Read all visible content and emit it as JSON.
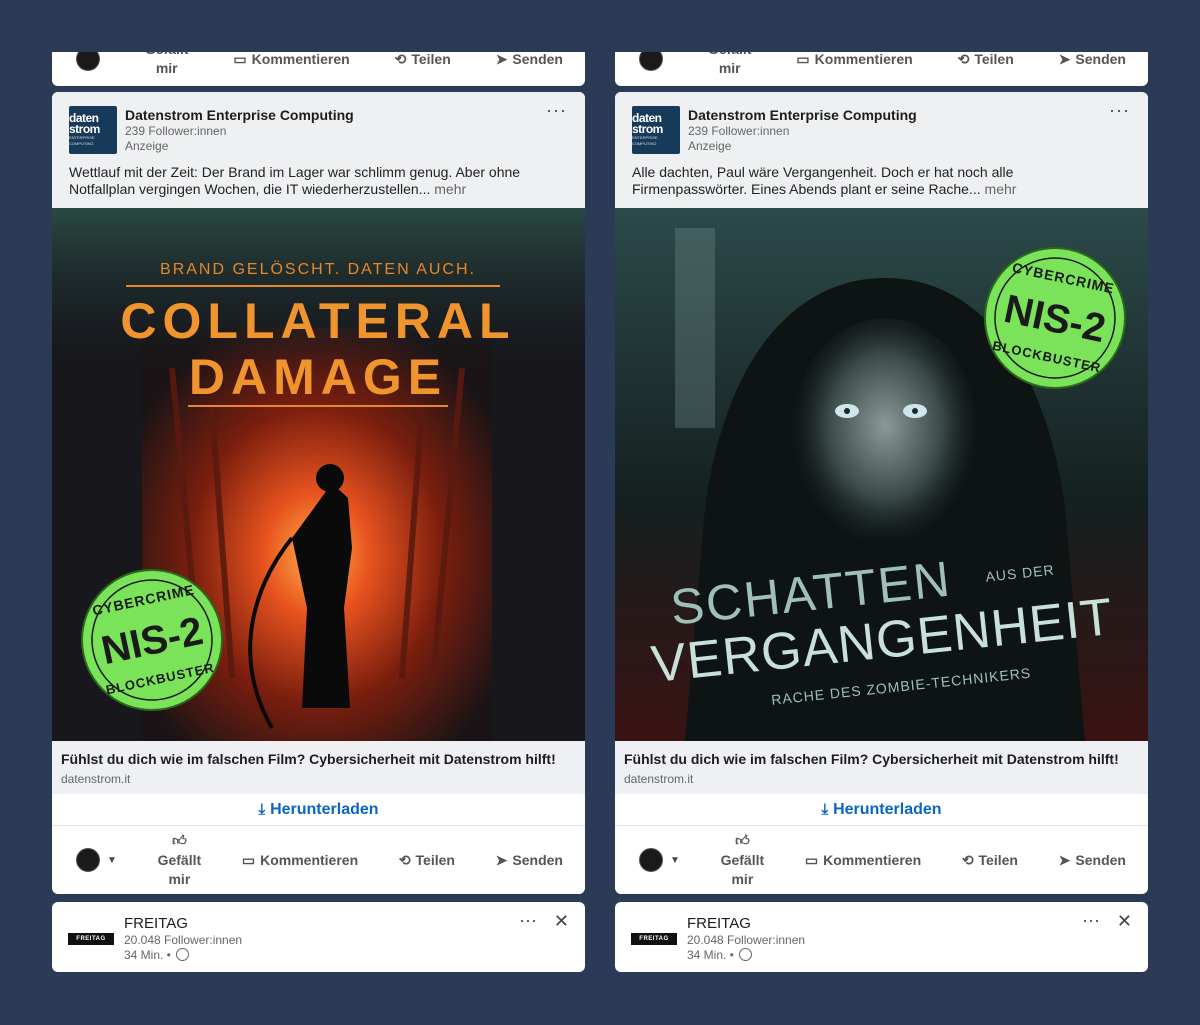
{
  "posts": [
    {
      "company": "Datenstrom Enterprise Computing",
      "followers": "239 Follower:innen",
      "sponsored": "Anzeige",
      "logo_main": "daten strom",
      "logo_sub": "ENTERPRISE COMPUTING",
      "text": "Wettlauf mit der Zeit: Der Brand im Lager war schlimm genug. Aber ohne Notfallplan vergingen Wochen, die IT wiederherzustellen...",
      "more": "mehr",
      "poster": {
        "tagline": "BRAND GELÖSCHT. DATEN AUCH.",
        "title_line1": "COLLATERAL",
        "title_line2": "DAMAGE",
        "badge_top": "CYBERCRIME",
        "badge_mid": "NIS-2",
        "badge_bottom": "BLOCKBUSTER"
      },
      "link_title": "Fühlst du dich wie im falschen Film? Cybersicherheit mit Datenstrom hilft!",
      "link_domain": "datenstrom.it"
    },
    {
      "company": "Datenstrom Enterprise Computing",
      "followers": "239 Follower:innen",
      "sponsored": "Anzeige",
      "logo_main": "daten strom",
      "logo_sub": "ENTERPRISE COMPUTING",
      "text": "Alle dachten, Paul wäre Vergangenheit. Doch er hat noch alle Firmenpasswörter. Eines Abends plant er seine Rache...",
      "more": "mehr",
      "poster": {
        "title_line1": "SCHATTEN",
        "title_small": "AUS DER",
        "title_line2": "VERGANGENHEIT",
        "subtitle": "RACHE DES ZOMBIE-TECHNIKERS",
        "badge_top": "CYBERCRIME",
        "badge_mid": "NIS-2",
        "badge_bottom": "BLOCKBUSTER"
      },
      "link_title": "Fühlst du dich wie im falschen Film? Cybersicherheit mit Datenstrom hilft!",
      "link_domain": "datenstrom.it"
    }
  ],
  "actions": {
    "download": "Herunterladen",
    "like_line1": "Gefällt",
    "like_line2": "mir",
    "comment": "Kommentieren",
    "share": "Teilen",
    "send": "Senden"
  },
  "next_post": {
    "name": "FREITAG",
    "logo": "FREITAG",
    "followers": "20.048 Follower:innen",
    "time": "34 Min. •"
  },
  "icons": {
    "more": "more-dots-icon",
    "close": "close-icon",
    "like": "thumbs-up-icon",
    "comment": "comment-icon",
    "share": "repost-icon",
    "send": "send-icon",
    "download": "download-icon",
    "globe": "globe-icon"
  },
  "colors": {
    "background": "#2b3a56",
    "link_blue": "#0a66c2",
    "badge_green": "#7be35a",
    "poster_orange": "#e8862a"
  }
}
